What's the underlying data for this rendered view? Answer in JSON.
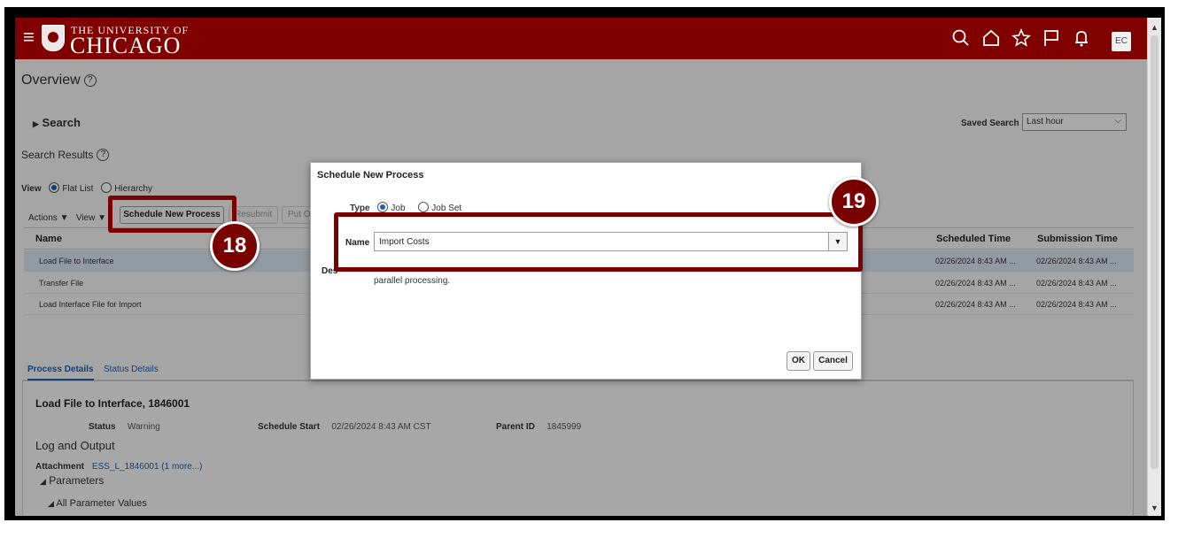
{
  "header": {
    "brand_top": "THE UNIVERSITY OF",
    "brand_main": "CHICAGO",
    "avatar": "EC",
    "brand_color": "#800000"
  },
  "page": {
    "title": "Overview",
    "search_label": "Search",
    "saved_search_label": "Saved Search",
    "saved_search_value": "Last hour",
    "search_results_label": "Search Results",
    "view_label": "View",
    "view_options": [
      "Flat List",
      "Hierarchy"
    ],
    "actions_label": "Actions",
    "view_menu_label": "View",
    "schedule_new_process": "Schedule New Process",
    "resubmit": "Resubmit",
    "put_on_hold": "Put O"
  },
  "table": {
    "columns": [
      "Name",
      "Scheduled Time",
      "Submission Time"
    ],
    "rows": [
      {
        "name": "Load File to Interface",
        "scheduled": "02/26/2024 8:43 AM ...",
        "submitted": "02/26/2024 8:43 AM ..."
      },
      {
        "name": "Transfer File",
        "scheduled": "02/26/2024 8:43 AM ...",
        "submitted": "02/26/2024 8:43 AM ..."
      },
      {
        "name": "Load Interface File for Import",
        "scheduled": "02/26/2024 8:43 AM ...",
        "submitted": "02/26/2024 8:43 AM ..."
      }
    ]
  },
  "details": {
    "tabs": [
      "Process Details",
      "Status Details"
    ],
    "title": "Load File to Interface, 1846001",
    "status_label": "Status",
    "status_value": "Warning",
    "schedule_start_label": "Schedule Start",
    "schedule_start_value": "02/26/2024 8:43 AM CST",
    "parent_id_label": "Parent ID",
    "parent_id_value": "1845999",
    "log_output": "Log and Output",
    "attachment_label": "Attachment",
    "attachment_value": "ESS_L_1846001 (1 more...)",
    "parameters": "Parameters",
    "all_parameter_values": "All Parameter Values"
  },
  "dialog": {
    "title": "Schedule New Process",
    "type_label": "Type",
    "type_options": [
      "Job",
      "Job Set"
    ],
    "name_label": "Name",
    "name_value": "Import Costs",
    "desc_label": "Des",
    "desc_text": "parallel processing.",
    "ok": "OK",
    "cancel": "Cancel"
  },
  "callouts": {
    "step_18": "18",
    "step_19": "19",
    "color": "#7a0000"
  }
}
